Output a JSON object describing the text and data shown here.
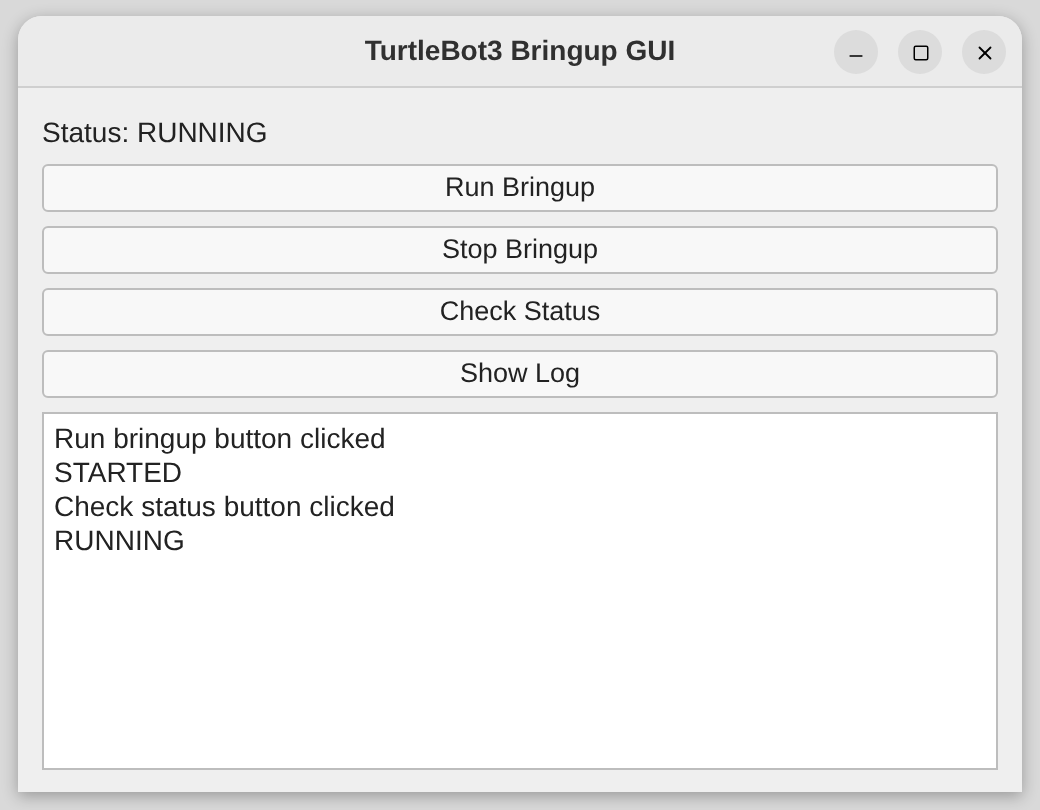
{
  "window": {
    "title": "TurtleBot3 Bringup GUI"
  },
  "status_label": "Status: RUNNING",
  "buttons": [
    "Run Bringup",
    "Stop Bringup",
    "Check Status",
    "Show Log"
  ],
  "log": [
    "Run bringup button clicked",
    "STARTED",
    "Check status button clicked",
    "RUNNING"
  ]
}
